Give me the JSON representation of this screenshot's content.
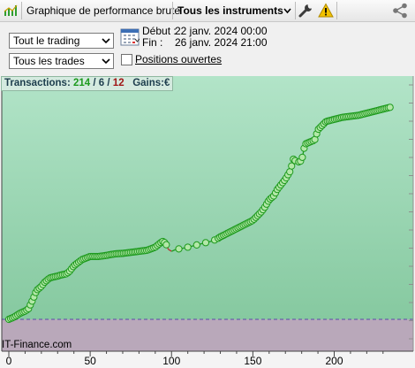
{
  "toolbar": {
    "title": "Graphique de performance brute",
    "instruments_label": "Tous les instruments",
    "icons": [
      "equity-curve-icon",
      "chevron-down-icon",
      "wrench-icon",
      "warning-icon",
      "share-icon"
    ],
    "warning_color": "#f2c200"
  },
  "filters": {
    "trading_select": "Tout le trading",
    "trades_select": "Tous les trades",
    "open_positions_label": "Positions ouvertes",
    "open_positions_checked": false
  },
  "period": {
    "start_label": "Début :",
    "start_value": "22 janv. 2024 00:00",
    "end_label": "Fin :",
    "end_value": "26 janv. 2024 21:00"
  },
  "stats": {
    "transactions_label": "Transactions:",
    "wins": "214",
    "separator": "/",
    "neutral": "6",
    "losses": "12",
    "gains_label": "Gains:",
    "gains_currency": "€"
  },
  "watermark": "IT-Finance.com",
  "chart_data": {
    "type": "line",
    "x_ticks": [
      0,
      50,
      100,
      150,
      200
    ],
    "xlim": [
      -2,
      250
    ],
    "colors": {
      "win": "#1e9a1e",
      "loss": "#b83232",
      "bg_positive": "#a6dcbe",
      "bg_negative": "#b9a8ba",
      "zero_line": "#5a4aa8"
    },
    "series": [
      {
        "x": [
          0,
          3,
          5,
          7,
          10,
          12,
          15,
          17,
          20,
          22,
          25,
          27,
          30,
          32,
          35,
          37,
          40,
          45,
          50,
          55,
          60,
          63,
          66,
          70,
          75,
          80,
          85,
          90,
          93,
          95,
          97,
          98,
          100,
          103,
          107,
          110,
          115,
          120,
          125,
          128,
          130,
          135,
          140,
          145,
          150,
          155,
          157,
          160,
          163,
          165,
          168,
          170,
          173,
          175,
          177,
          180,
          182,
          185,
          188,
          190,
          195,
          200,
          205,
          210,
          215,
          220,
          225,
          230,
          235
        ],
        "y": [
          0,
          1,
          2,
          3,
          4,
          5,
          10,
          14,
          16,
          18,
          20,
          20.5,
          21,
          21.5,
          22,
          23,
          26,
          29,
          30.5,
          30.5,
          31,
          31.5,
          31.8,
          32,
          32.5,
          33,
          33.5,
          35,
          37,
          38,
          36,
          34,
          33,
          34,
          34.5,
          35,
          36,
          37,
          38,
          39,
          40,
          42,
          44,
          46,
          48,
          52,
          54,
          58,
          60,
          63,
          66,
          68,
          72,
          78,
          76,
          77,
          85,
          86,
          87,
          92,
          96,
          97,
          98,
          98.5,
          99,
          100,
          101,
          102,
          103
        ],
        "loss_ranges": [
          [
            97,
            101
          ],
          [
            176,
            178
          ]
        ]
      }
    ]
  }
}
